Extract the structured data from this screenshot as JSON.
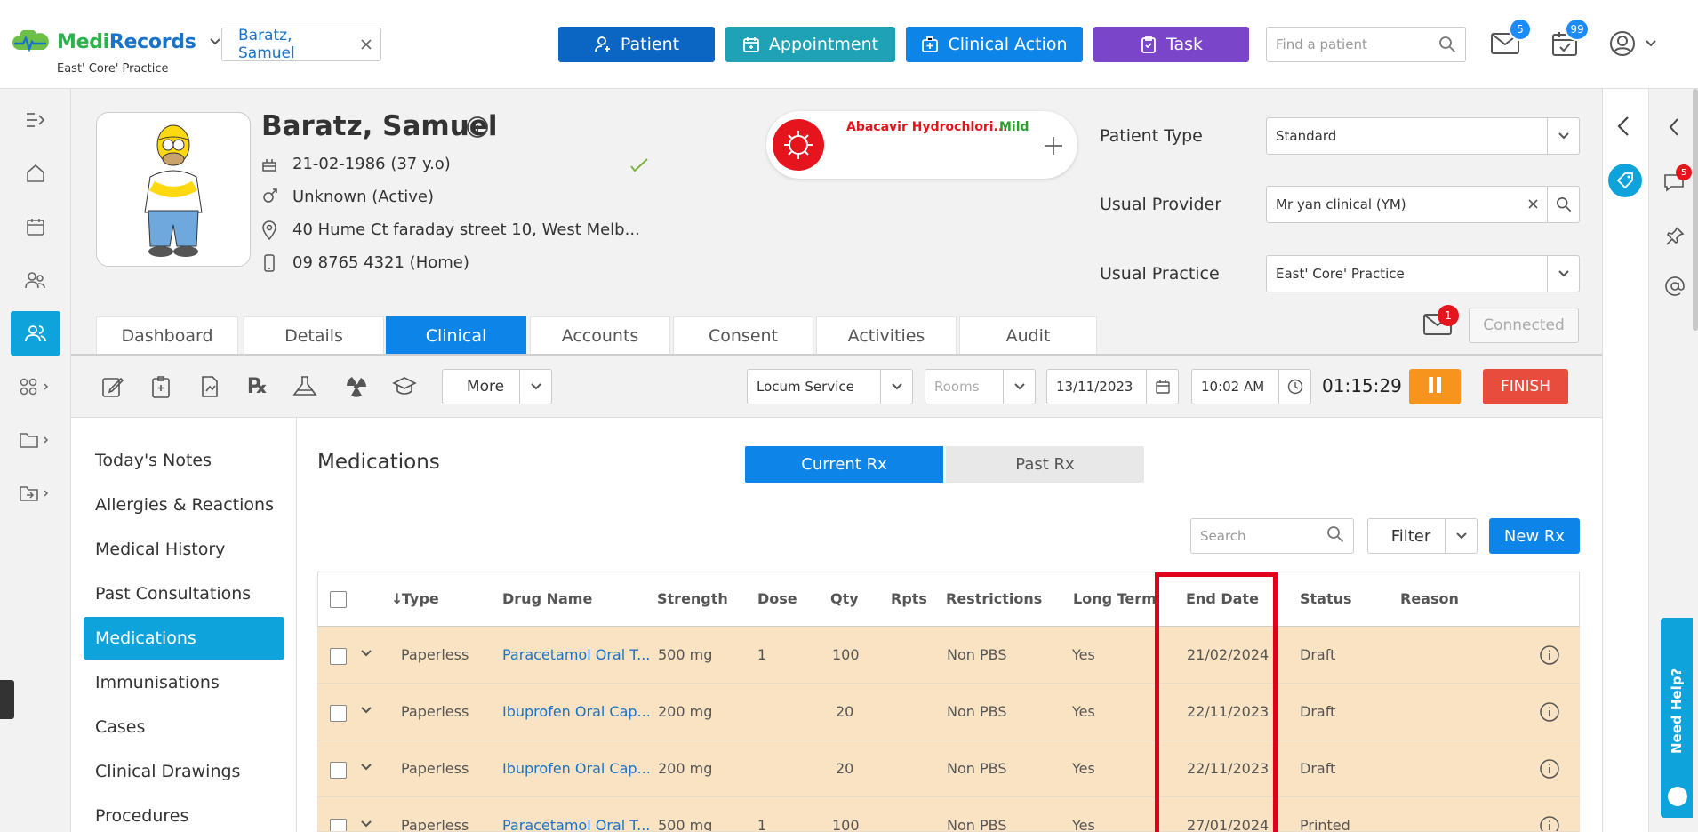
{
  "app": {
    "brand_part1": "Medi",
    "brand_part2": "Records",
    "practice": "East' Core' Practice",
    "patient_tab": "Baratz, Samuel",
    "buttons": {
      "patient": "Patient",
      "appointment": "Appointment",
      "clinical_action": "Clinical Action",
      "task": "Task"
    },
    "search_placeholder": "Find a patient",
    "mail_count": "5",
    "tasks_count": "99",
    "colors": {
      "patient": "#0a66c2",
      "appointment": "#1fa2b5",
      "clinical_action": "#0d84e8",
      "task": "#7b45c9",
      "accent": "#0fa3dc"
    }
  },
  "patient": {
    "name": "Baratz, Samuel",
    "dob": "21-02-1986 (37 y.o)",
    "gender": "Unknown (Active)",
    "address": "40 Hume Ct faraday street 10, West Melb...",
    "phone": "09 8765 4321 (Home)",
    "allergy_name": "Abacavir Hydrochlori...",
    "allergy_severity": "Mild"
  },
  "fields": {
    "patient_type_label": "Patient Type",
    "patient_type_value": "Standard",
    "usual_provider_label": "Usual Provider",
    "usual_provider_value": "Mr yan clinical (YM)",
    "usual_practice_label": "Usual Practice",
    "usual_practice_value": "East' Core' Practice"
  },
  "tabs": [
    "Dashboard",
    "Details",
    "Clinical",
    "Accounts",
    "Consent",
    "Activities",
    "Audit"
  ],
  "messages_count": "1",
  "connection": "Connected",
  "toolbar": {
    "more": "More",
    "service": "Locum Service",
    "rooms_placeholder": "Rooms",
    "date": "13/11/2023",
    "time": "10:02 AM",
    "timer": "01:15:29",
    "finish": "FINISH"
  },
  "menu": [
    "Today's Notes",
    "Allergies & Reactions",
    "Medical History",
    "Past Consultations",
    "Medications",
    "Immunisations",
    "Cases",
    "Clinical Drawings",
    "Procedures"
  ],
  "medications": {
    "title": "Medications",
    "toggle_current": "Current Rx",
    "toggle_past": "Past Rx",
    "search_placeholder": "Search",
    "filter": "Filter",
    "new_rx": "New Rx",
    "columns": [
      "Type",
      "Drug Name",
      "Strength",
      "Dose",
      "Qty",
      "Rpts",
      "Restrictions",
      "Long Term",
      "End Date",
      "Status",
      "Reason"
    ],
    "rows": [
      {
        "type": "Paperless",
        "drug": "Paracetamol Oral T...",
        "strength": "500 mg",
        "dose": "1",
        "qty": "100",
        "rpts": "",
        "restrictions": "Non PBS",
        "long_term": "Yes",
        "end_date": "21/02/2024",
        "status": "Draft",
        "reason": ""
      },
      {
        "type": "Paperless",
        "drug": "Ibuprofen Oral Cap...",
        "strength": "200 mg",
        "dose": "",
        "qty": "20",
        "rpts": "",
        "restrictions": "Non PBS",
        "long_term": "Yes",
        "end_date": "22/11/2023",
        "status": "Draft",
        "reason": ""
      },
      {
        "type": "Paperless",
        "drug": "Ibuprofen Oral Cap...",
        "strength": "200 mg",
        "dose": "",
        "qty": "20",
        "rpts": "",
        "restrictions": "Non PBS",
        "long_term": "Yes",
        "end_date": "22/11/2023",
        "status": "Draft",
        "reason": ""
      },
      {
        "type": "Paperless",
        "drug": "Paracetamol Oral T...",
        "strength": "500 mg",
        "dose": "1",
        "qty": "100",
        "rpts": "",
        "restrictions": "Non PBS",
        "long_term": "Yes",
        "end_date": "27/01/2024",
        "status": "Printed",
        "reason": ""
      }
    ]
  },
  "right_rail": {
    "chat_count": "5"
  },
  "helper": "Need Help?"
}
